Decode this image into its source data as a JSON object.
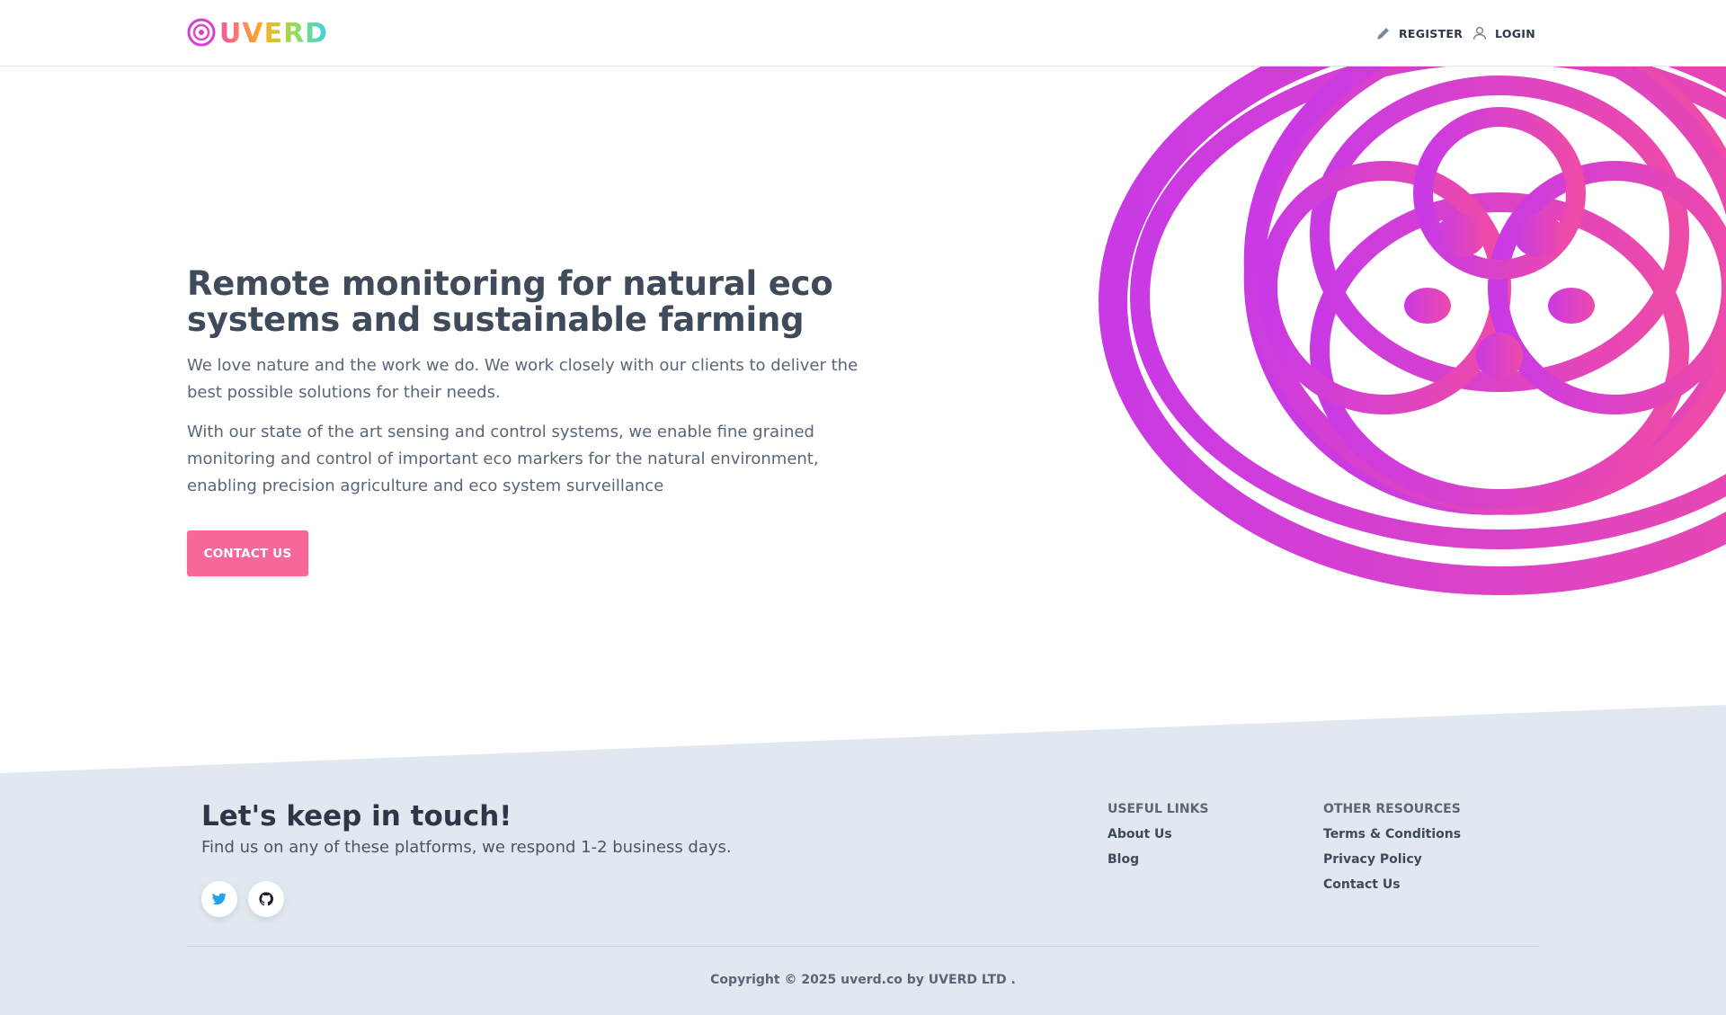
{
  "brand": {
    "logo_text": "UVERD",
    "colors": {
      "accent_pink": "#f7679a",
      "flower_start": "#c93ae4",
      "flower_end": "#ee4aa8",
      "footer_bg": "#e2e8f0",
      "text_dark": "#2d3748"
    }
  },
  "nav": {
    "register_label": "REGISTER",
    "login_label": "LOGIN",
    "register_icon": "pencil-icon",
    "login_icon": "user-icon"
  },
  "hero": {
    "title_line1": "Remote monitoring for natural eco",
    "title_line2": "systems and sustainable farming",
    "paragraph1": "We love nature and the work we do. We work closely with our clients to deliver the best possible solutions for their needs.",
    "paragraph2": "With our state of the art sensing and control systems, we enable fine grained monitoring and control of important eco markers for the natural environment, enabling precision agriculture and eco system surveillance",
    "cta_label": "CONTACT US"
  },
  "footer": {
    "title": "Let's keep in touch!",
    "subtitle": "Find us on any of these platforms, we respond 1-2 business days.",
    "social": [
      {
        "icon": "twitter-icon",
        "color": "#1da1f2"
      },
      {
        "icon": "github-icon",
        "color": "#1a202c"
      }
    ],
    "useful_links": {
      "heading": "USEFUL LINKS",
      "items": [
        "About Us",
        "Blog"
      ]
    },
    "other_resources": {
      "heading": "OTHER RESOURCES",
      "items": [
        "Terms & Conditions",
        "Privacy Policy",
        "Contact Us"
      ]
    },
    "copyright": "Copyright © 2025 uverd.co by UVERD LTD ."
  }
}
